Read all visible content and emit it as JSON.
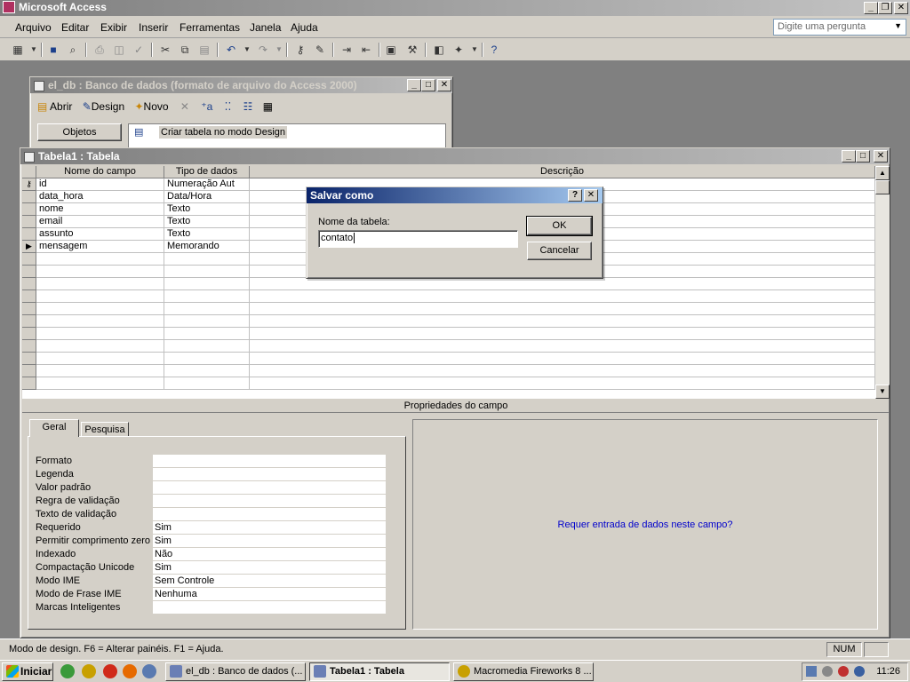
{
  "app": {
    "title": "Microsoft Access",
    "menu": [
      "Arquivo",
      "Editar",
      "Exibir",
      "Inserir",
      "Ferramentas",
      "Janela",
      "Ajuda"
    ],
    "ask_placeholder": "Digite uma pergunta"
  },
  "db_window": {
    "title": "el_db : Banco de dados (formato de arquivo do Access 2000)",
    "toolbar": {
      "open": "Abrir",
      "design": "Design",
      "new": "Novo"
    },
    "objects_label": "Objetos",
    "create_item": "Criar tabela no modo Design"
  },
  "table_window": {
    "title": "Tabela1 : Tabela",
    "columns": [
      "Nome do campo",
      "Tipo de dados",
      "Descrição"
    ],
    "rows": [
      {
        "name": "id",
        "type": "Numeração Aut",
        "key": true
      },
      {
        "name": "data_hora",
        "type": "Data/Hora"
      },
      {
        "name": "nome",
        "type": "Texto"
      },
      {
        "name": "email",
        "type": "Texto"
      },
      {
        "name": "assunto",
        "type": "Texto"
      },
      {
        "name": "mensagem",
        "type": "Memorando",
        "current": true
      }
    ],
    "field_props_title": "Propriedades do campo",
    "tabs": [
      "Geral",
      "Pesquisa"
    ],
    "properties": [
      {
        "label": "Formato",
        "value": ""
      },
      {
        "label": "Legenda",
        "value": ""
      },
      {
        "label": "Valor padrão",
        "value": ""
      },
      {
        "label": "Regra de validação",
        "value": ""
      },
      {
        "label": "Texto de validação",
        "value": ""
      },
      {
        "label": "Requerido",
        "value": "Sim"
      },
      {
        "label": "Permitir comprimento zero",
        "value": "Sim"
      },
      {
        "label": "Indexado",
        "value": "Não"
      },
      {
        "label": "Compactação Unicode",
        "value": "Sim"
      },
      {
        "label": "Modo IME",
        "value": "Sem Controle"
      },
      {
        "label": "Modo de Frase IME",
        "value": "Nenhuma"
      },
      {
        "label": "Marcas Inteligentes",
        "value": ""
      }
    ],
    "help_text": "Requer entrada de dados neste campo?",
    "help_color": "#0000cc"
  },
  "dialog": {
    "title": "Salvar como",
    "label": "Nome da tabela:",
    "value": "contato",
    "ok": "OK",
    "cancel": "Cancelar",
    "help": "?",
    "close": "✕"
  },
  "status": {
    "text": "Modo de design.  F6 = Alterar painéis.  F1 = Ajuda.",
    "num": "NUM"
  },
  "taskbar": {
    "start": "Iniciar",
    "tasks": [
      {
        "label": "el_db : Banco de dados (...",
        "pressed": false
      },
      {
        "label": "Tabela1 : Tabela",
        "pressed": true
      },
      {
        "label": "Macromedia Fireworks 8 ...",
        "pressed": false
      }
    ],
    "clock": "11:26"
  }
}
